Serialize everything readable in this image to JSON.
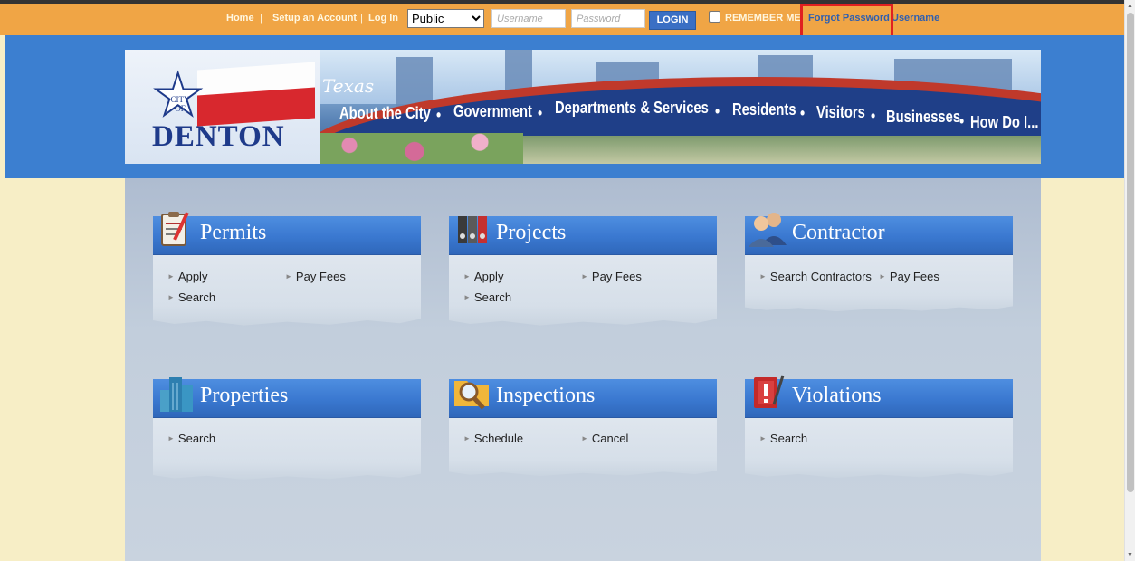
{
  "top_bar": {
    "home": "Home",
    "sep1": "|",
    "setup_account": "Setup an Account",
    "sep2": "|",
    "log_in": "Log In",
    "role_select": "Public",
    "username_placeholder": "Username",
    "password_placeholder": "Password",
    "login_button": "LOGIN",
    "remember_me": "REMEMBER ME",
    "forgot_password": "Forgot Password",
    "username_link": "Username",
    "highlight_color": "#e02020"
  },
  "banner": {
    "city_of": "CITY OF",
    "city_name": "DENTON",
    "state_script": "Texas",
    "nav": [
      "About the City",
      "Government",
      "Departments & Services",
      "Residents",
      "Visitors",
      "Businesses",
      "How Do I..."
    ],
    "nav_separator": "•"
  },
  "cards": {
    "permits": {
      "title": "Permits",
      "icon": "clipboard-pencil-icon",
      "links": [
        "Apply",
        "Pay Fees",
        "Search"
      ]
    },
    "projects": {
      "title": "Projects",
      "icon": "binders-icon",
      "links": [
        "Apply",
        "Pay Fees",
        "Search"
      ]
    },
    "contractor": {
      "title": "Contractor",
      "icon": "people-icon",
      "links": [
        "Search Contractors",
        "Pay Fees"
      ]
    },
    "properties": {
      "title": "Properties",
      "icon": "buildings-icon",
      "links": [
        "Search"
      ]
    },
    "inspections": {
      "title": "Inspections",
      "icon": "folder-magnifier-icon",
      "links": [
        "Schedule",
        "Cancel"
      ]
    },
    "violations": {
      "title": "Violations",
      "icon": "notebook-exclamation-icon",
      "links": [
        "Search"
      ]
    }
  },
  "colors": {
    "login_bar": "#f0a545",
    "header_band": "#3c7fd0",
    "card_header": "#3a78d0",
    "page_bg": "#f7eec6"
  }
}
